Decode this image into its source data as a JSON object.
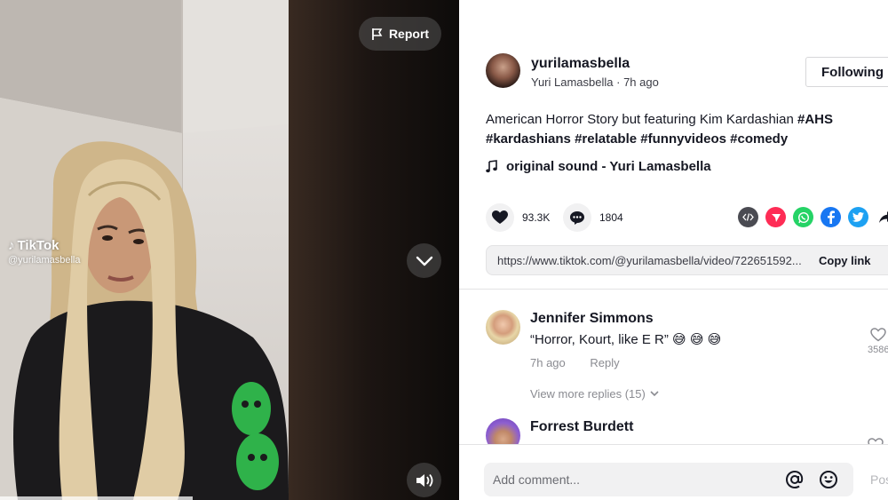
{
  "video": {
    "watermark_brand": "TikTok",
    "watermark_user": "@yurilamasbella",
    "report_label": "Report",
    "progress": 0.42
  },
  "author": {
    "username": "yurilamasbella",
    "display_name": "Yuri Lamasbella",
    "time_ago": "7h ago",
    "follow_label": "Following"
  },
  "caption": {
    "text": "American Horror Story but featuring Kim Kardashian",
    "hashtags": [
      "#AHS",
      "#kardashians",
      "#relatable",
      "#funnyvideos",
      "#comedy"
    ]
  },
  "music": {
    "label": "original sound - Yuri Lamasbella"
  },
  "stats": {
    "likes": "93.3K",
    "comments": "1804"
  },
  "share": {
    "icons": [
      "embed-icon",
      "send-icon",
      "whatsapp-icon",
      "facebook-icon",
      "twitter-icon",
      "share-arrow-icon"
    ],
    "colors": {
      "embed": "#4a4b52",
      "send": "#fe2c55",
      "whatsapp": "#25d366",
      "facebook": "#1877f2",
      "twitter": "#1da1f2"
    }
  },
  "link": {
    "url": "https://www.tiktok.com/@yurilamasbella/video/722651592...",
    "copy_label": "Copy link"
  },
  "comments": [
    {
      "name": "Jennifer Simmons",
      "text": "“Horror, Kourt, like E R” 😅 😅 😅",
      "time": "7h ago",
      "reply_label": "Reply",
      "likes": "3586",
      "more_replies": "View more replies (15)"
    },
    {
      "name": "Forrest Burdett"
    }
  ],
  "composer": {
    "placeholder": "Add comment...",
    "post_label": "Post"
  }
}
